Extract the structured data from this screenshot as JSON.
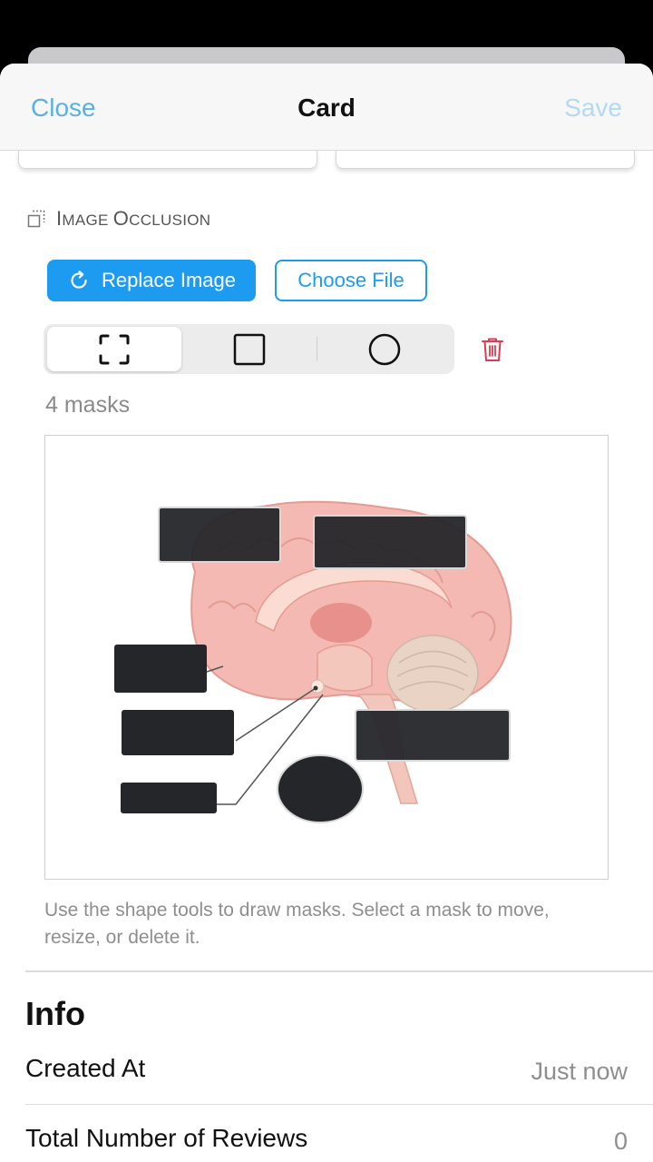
{
  "nav": {
    "close_label": "Close",
    "title": "Card",
    "save_label": "Save"
  },
  "section": {
    "icon": "image-occlusion-icon",
    "title_parts": [
      {
        "text": "I",
        "size": "big"
      },
      {
        "text": "MAGE ",
        "size": "small"
      },
      {
        "text": "O",
        "size": "big"
      },
      {
        "text": "CCLUSION",
        "size": "small"
      }
    ]
  },
  "buttons": {
    "replace_label": "Replace Image",
    "choose_label": "Choose File"
  },
  "tools": {
    "items": [
      "select-tool",
      "rectangle-tool",
      "ellipse-tool"
    ],
    "active": "select-tool"
  },
  "mask_count": "4 masks",
  "hint": "Use the shape tools to draw masks. Select a mask to move, resize, or delete it.",
  "info": {
    "title": "Info",
    "rows": [
      {
        "label": "Created At",
        "value": "Just now"
      },
      {
        "label": "Total Number of Reviews",
        "value": "0"
      }
    ]
  },
  "colors": {
    "accent": "#1d9bf0",
    "nav_link": "#5ab0e6",
    "nav_disabled": "#b3daf2",
    "delete": "#e03a4e",
    "mask": "#25262a"
  }
}
